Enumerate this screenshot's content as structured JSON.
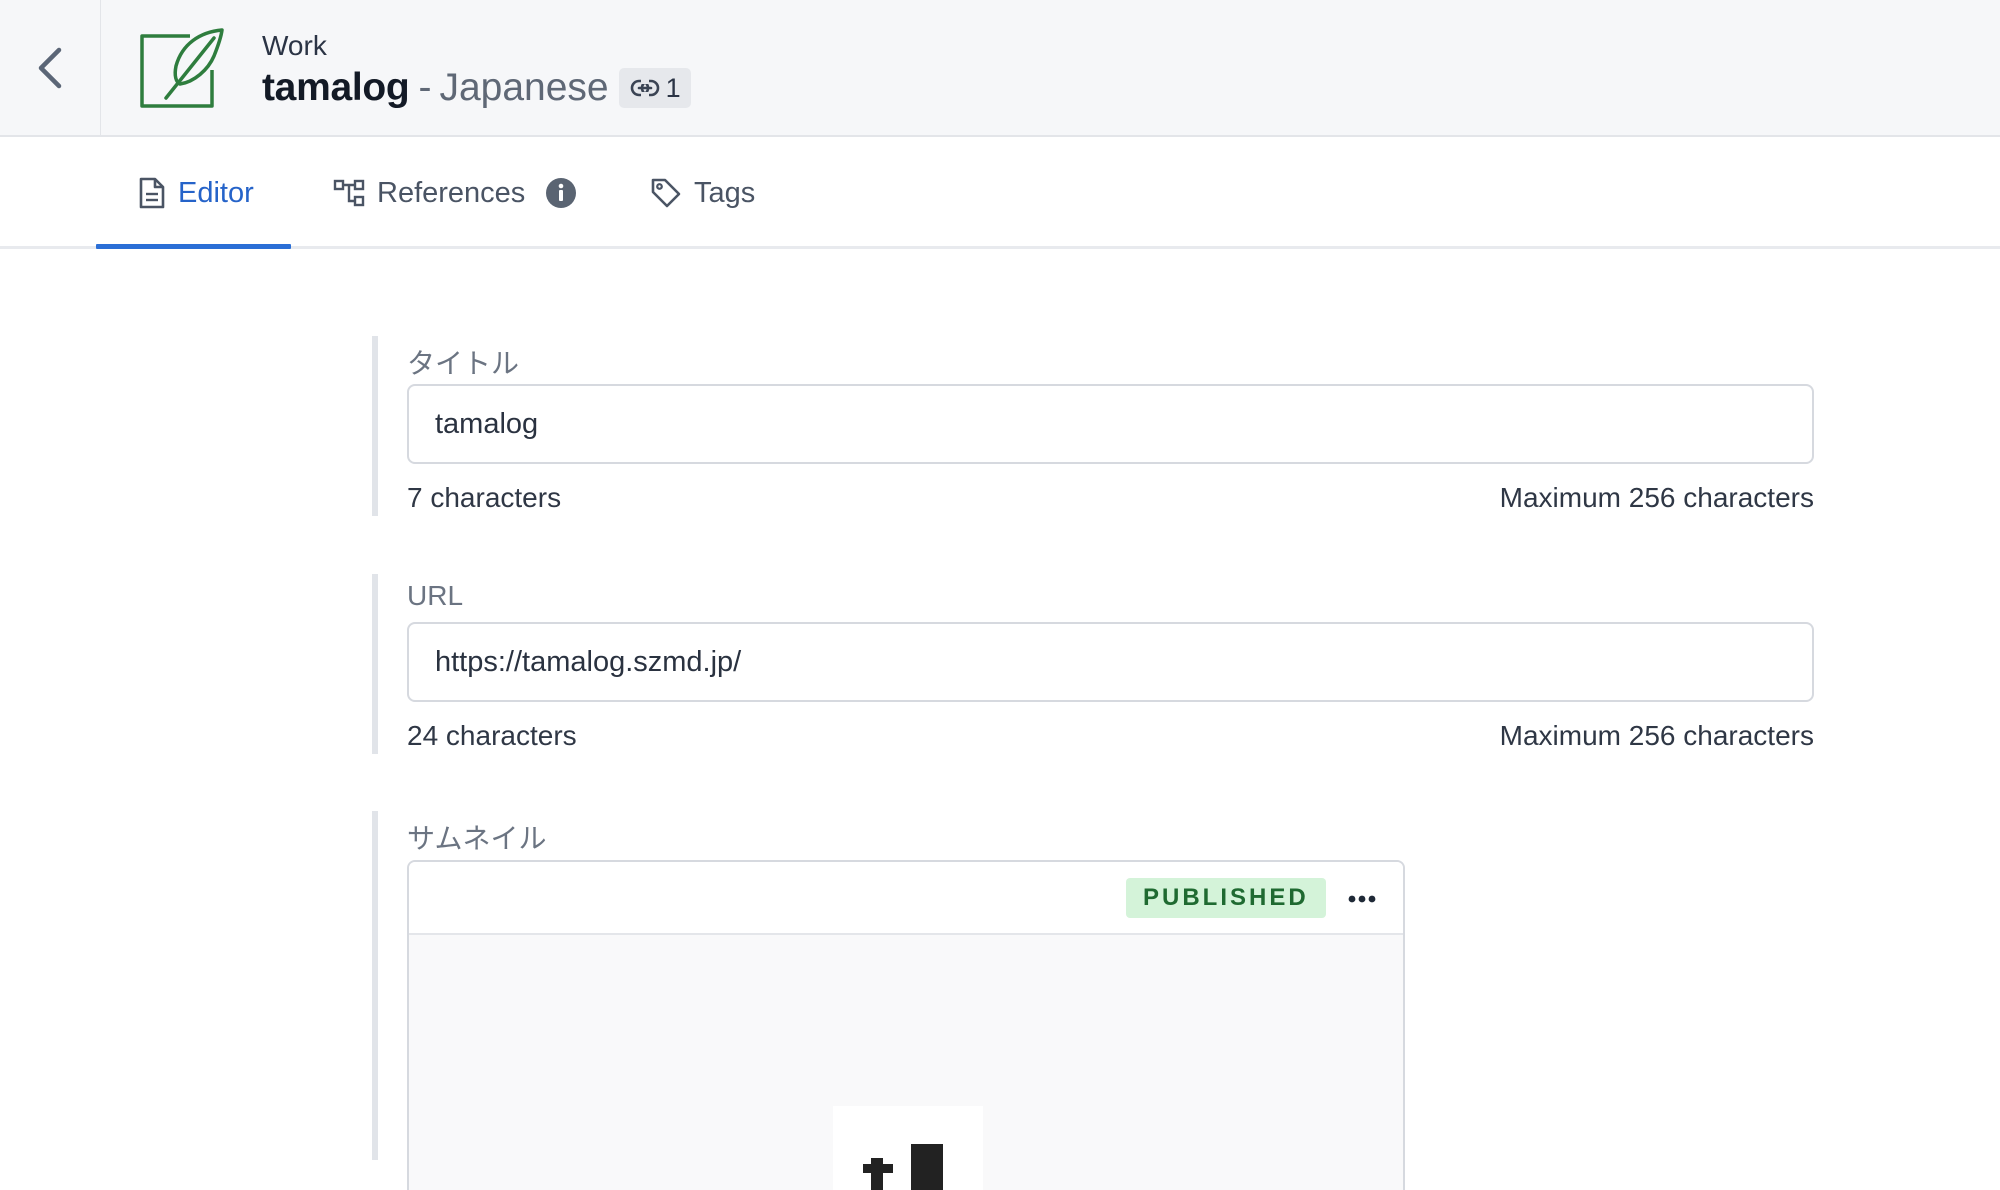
{
  "header": {
    "back_label": "Back",
    "type_label": "Work",
    "title": "tamalog",
    "separator": "-",
    "locale": "Japanese",
    "reference_count": "1",
    "icon_color": "#2e7d3e"
  },
  "tabs": [
    {
      "label": "Editor",
      "icon": "document-icon",
      "active": true
    },
    {
      "label": "References",
      "icon": "references-icon",
      "active": false
    },
    {
      "label": "Tags",
      "icon": "tag-icon",
      "active": false
    }
  ],
  "form": {
    "title_field": {
      "label": "タイトル",
      "value": "tamalog",
      "count": "7 characters",
      "max": "Maximum 256 characters"
    },
    "url_field": {
      "label": "URL",
      "value": "https://tamalog.szmd.jp/",
      "count": "24 characters",
      "max": "Maximum 256 characters"
    },
    "thumbnail_field": {
      "label": "サムネイル",
      "status": "PUBLISHED"
    }
  },
  "colors": {
    "accent": "#2563c9",
    "published_bg": "#d4f3d9",
    "published_text": "#1f6a31"
  }
}
